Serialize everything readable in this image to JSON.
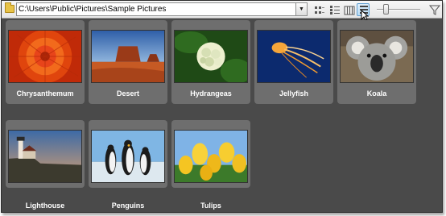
{
  "toolbar": {
    "path": "C:\\Users\\Public\\Pictures\\Sample Pictures",
    "view_modes": [
      "thumbnail-grid-icon",
      "details-list-icon",
      "film-strip-icon",
      "large-tiles-icon"
    ],
    "active_view": "large-tiles-icon"
  },
  "gallery": {
    "items": [
      {
        "label": "Chrysanthemum"
      },
      {
        "label": "Desert"
      },
      {
        "label": "Hydrangeas"
      },
      {
        "label": "Jellyfish"
      },
      {
        "label": "Koala"
      },
      {
        "label": "Lighthouse"
      },
      {
        "label": "Penguins"
      },
      {
        "label": "Tulips"
      }
    ]
  },
  "colors": {
    "background": "#4a4a4a",
    "tile": "#6e6e6e",
    "caption": "#ffffff",
    "active_button": "#b9dcf5"
  }
}
